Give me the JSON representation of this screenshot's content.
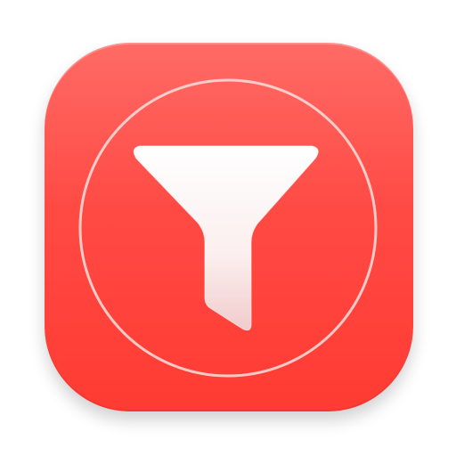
{
  "app_icon": {
    "name": "filter-app-icon",
    "glyph": "funnel-icon",
    "colors": {
      "background_top": "#ff6b66",
      "background_bottom": "#ff3b33",
      "ring": "#ffd6d3",
      "glyph_top": "#ffffff",
      "glyph_bottom": "#f3d0d0"
    }
  }
}
